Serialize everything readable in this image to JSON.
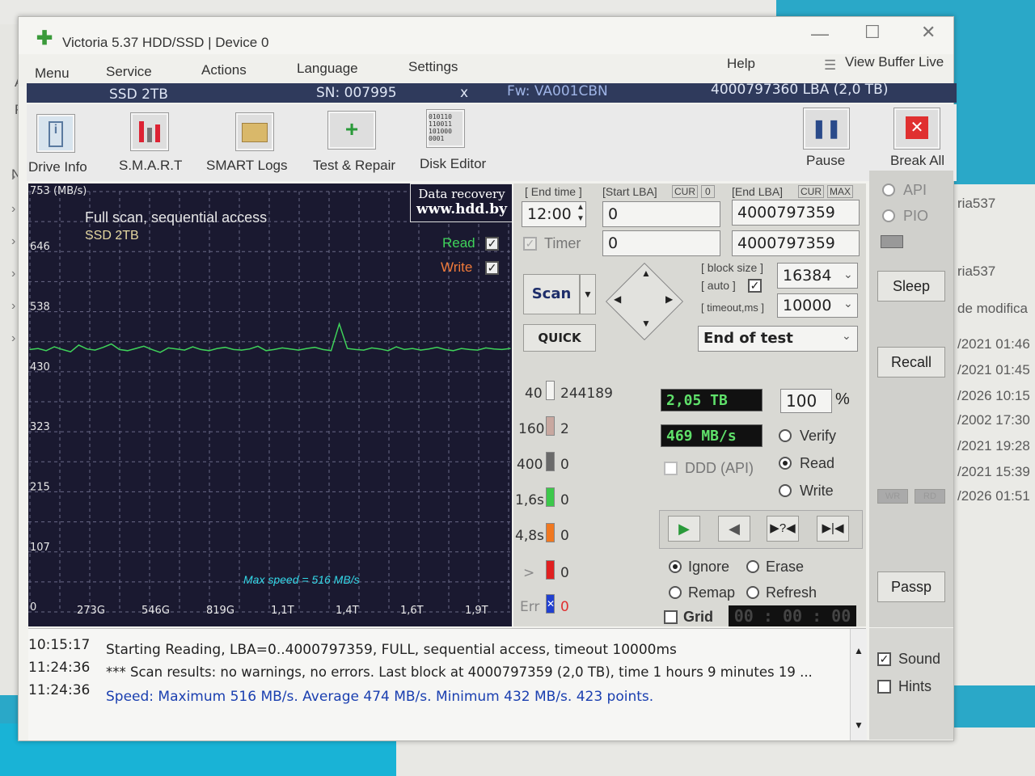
{
  "background": {
    "left_letters": [
      "A",
      "P",
      "N"
    ],
    "right_items": [
      "ria537",
      "ria537",
      "de modifica",
      "/2021 01:46",
      "/2021 01:45",
      "/2026 10:15",
      "/2002 17:30",
      "/2021 19:28",
      "/2021 15:39",
      "/2026 01:51"
    ]
  },
  "window": {
    "title": "Victoria 5.37 HDD/SSD | Device 0"
  },
  "menu": {
    "items": [
      "Menu",
      "Service",
      "Actions",
      "Language",
      "Settings",
      "Help",
      "View Buffer Live"
    ]
  },
  "device_info": {
    "model": "SSD 2TB",
    "serial": "SN: 007995",
    "close": "x",
    "firmware": "Fw: VA001CBN",
    "capacity": "4000797360 LBA (2,0 TB)"
  },
  "toolbar": {
    "drive_info": "Drive Info",
    "smart": "S.M.A.R.T",
    "smart_logs": "SMART Logs",
    "test_repair": "Test & Repair",
    "disk_editor": "Disk Editor",
    "pause": "Pause",
    "break_all": "Break All"
  },
  "graph": {
    "y_unit": "753 (MB/s)",
    "title": "Full scan, sequential access",
    "device": "SSD 2TB",
    "recovery_line1": "Data recovery",
    "recovery_line2": "www.hdd.by",
    "read_label": "Read",
    "write_label": "Write",
    "y_ticks": [
      "646",
      "538",
      "430",
      "323",
      "215",
      "107",
      "0"
    ],
    "x_ticks": [
      "273G",
      "546G",
      "819G",
      "1,1T",
      "1,4T",
      "1,6T",
      "1,9T"
    ],
    "max_speed": "Max speed = 516 MB/s",
    "line_color": "#3fd35a"
  },
  "chart_data": {
    "type": "line",
    "title": "Full scan, sequential access",
    "ylabel": "(MB/s)",
    "ylim": [
      0,
      753
    ],
    "x_ticks": [
      "273G",
      "546G",
      "819G",
      "1,1T",
      "1,4T",
      "1,6T",
      "1,9T"
    ],
    "series": [
      {
        "name": "Read",
        "values": [
          470,
          472,
          468,
          475,
          470,
          466,
          478,
          471,
          469,
          474,
          480,
          470,
          468,
          472,
          476,
          470,
          465,
          473,
          471,
          469,
          475,
          470,
          468,
          472,
          474,
          470,
          469,
          471,
          476,
          468,
          470,
          473,
          471,
          469,
          472,
          474,
          470,
          468,
          516,
          472,
          470,
          469,
          473,
          471,
          468,
          475,
          470,
          472,
          469,
          471,
          474,
          470,
          468,
          472,
          470,
          469,
          473,
          471,
          470,
          472
        ]
      }
    ]
  },
  "scan": {
    "end_time_label": "[ End time ]",
    "end_time": "12:00",
    "start_lba_label": "[Start LBA]",
    "cur": "CUR",
    "zero_btn": "0",
    "start_lba": "0",
    "end_lba_label": "[End LBA]",
    "max": "MAX",
    "end_lba": "4000797359",
    "timer_label": "Timer",
    "timer_value": "0",
    "end_lba2": "4000797359",
    "block_size_label": "[ block size ]",
    "auto_label": "[ auto ]",
    "block_size": "16384",
    "timeout_label": "[ timeout,ms ]",
    "timeout": "10000",
    "scan_btn": "Scan",
    "quick_btn": "QUICK",
    "end_action": "End of test"
  },
  "blocks": {
    "rows": [
      {
        "label": "40",
        "count": "244189",
        "color": "#f4f4f2"
      },
      {
        "label": "160",
        "count": "2",
        "color": "#c8a8a0"
      },
      {
        "label": "400",
        "count": "0",
        "color": "#6a6a6a"
      },
      {
        "label": "1,6s",
        "count": "0",
        "color": "#3cc84a"
      },
      {
        "label": "4,8s",
        "count": "0",
        "color": "#f07820"
      },
      {
        "label": ">",
        "count": "0",
        "color": "#e02020"
      },
      {
        "label": "Err",
        "count": "0",
        "color": "#2040d0"
      }
    ]
  },
  "progress": {
    "done": "2,05 TB",
    "percent": "100",
    "percent_sign": "%",
    "speed": "469 MB/s",
    "ddd": "DDD (API)",
    "verify": "Verify",
    "read": "Read",
    "write": "Write"
  },
  "actions": {
    "ignore": "Ignore",
    "erase": "Erase",
    "remap": "Remap",
    "refresh": "Refresh",
    "grid": "Grid",
    "clock": "00 : 00 : 00"
  },
  "right_panel": {
    "api": "API",
    "pio": "PIO",
    "sleep": "Sleep",
    "recall": "Recall",
    "wr": "WR",
    "rd": "RD",
    "passp": "Passp",
    "sound": "Sound",
    "hints": "Hints"
  },
  "log": {
    "lines": [
      {
        "time": "10:15:17",
        "msg": "Starting Reading, LBA=0..4000797359, FULL, sequential access, timeout 10000ms",
        "color": "#222222"
      },
      {
        "time": "11:24:36",
        "msg": "*** Scan results: no warnings, no errors. Last block at 4000797359 (2,0 TB), time 1 hours 9 minutes 19 ...",
        "color": "#222222"
      },
      {
        "time": "11:24:36",
        "msg": "Speed: Maximum 516 MB/s. Average 474 MB/s. Minimum 432 MB/s. 423 points.",
        "color": "#1a3fb0"
      }
    ]
  }
}
